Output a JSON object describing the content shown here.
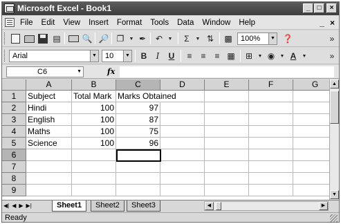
{
  "window": {
    "title": "Microsoft Excel - Book1",
    "controls": [
      "_",
      "□",
      "×"
    ]
  },
  "menu": {
    "items": [
      "File",
      "Edit",
      "View",
      "Insert",
      "Format",
      "Tools",
      "Data",
      "Window",
      "Help"
    ],
    "doc_controls": [
      "_",
      "×"
    ]
  },
  "toolbar": {
    "zoom": "100%",
    "sigma": "Σ"
  },
  "format_toolbar": {
    "font": "Arial",
    "size": "10",
    "bold": "B",
    "italic": "I",
    "underline": "U",
    "font_color_letter": "A"
  },
  "formula_bar": {
    "name_box": "C6",
    "fx": "fx",
    "value": ""
  },
  "grid": {
    "columns": [
      "A",
      "B",
      "C",
      "D",
      "E",
      "F",
      "G"
    ],
    "rows": [
      "1",
      "2",
      "3",
      "4",
      "5",
      "6",
      "7",
      "8",
      "9"
    ],
    "active_cell": "C6",
    "cells": {
      "A1": "Subject",
      "B1": "Total Mark",
      "C1": "Marks Obtained",
      "A2": "Hindi",
      "B2": "100",
      "C2": "97",
      "A3": "English",
      "B3": "100",
      "C3": "87",
      "A4": "Maths",
      "B4": "100",
      "C4": "75",
      "A5": "Science",
      "B5": "100",
      "C5": "96"
    }
  },
  "sheets": {
    "tabs": [
      "Sheet1",
      "Sheet2",
      "Sheet3"
    ],
    "active": "Sheet1"
  },
  "status": {
    "text": "Ready"
  }
}
